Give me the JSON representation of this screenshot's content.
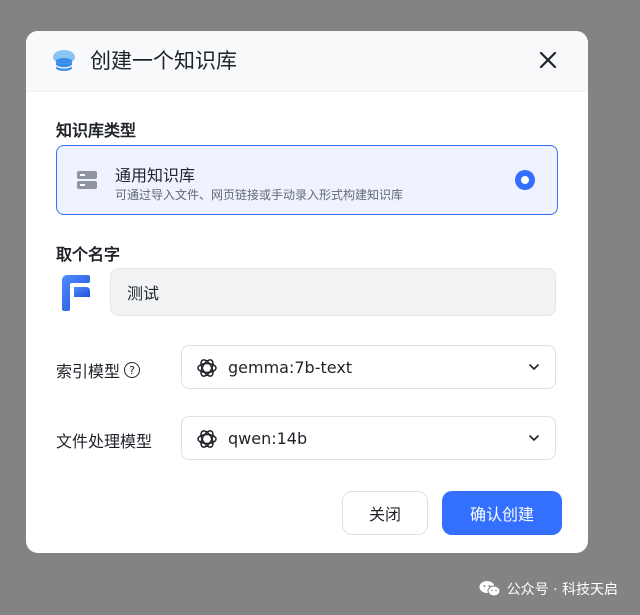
{
  "dialog": {
    "title": "创建一个知识库",
    "type_section_label": "知识库类型",
    "kb_type": {
      "title": "通用知识库",
      "description": "可通过导入文件、网页链接或手动录入形式构建知识库",
      "selected": true
    },
    "name_section_label": "取个名字",
    "name_value": "测试",
    "index_model": {
      "label": "索引模型",
      "value": "gemma:7b-text"
    },
    "file_model": {
      "label": "文件处理模型",
      "value": "qwen:14b"
    },
    "close_label": "关闭",
    "confirm_label": "确认创建"
  },
  "watermark": {
    "text": "公众号 · 科技天启"
  },
  "colors": {
    "accent": "#3370ff",
    "overlay": "#838383",
    "card_bg": "#eef3ff"
  },
  "icons": [
    "database-cloud-icon",
    "close-icon",
    "database-icon",
    "radio-checked-icon",
    "avatar-logo-icon",
    "help-icon",
    "openai-icon",
    "chevron-down-icon",
    "wechat-icon"
  ]
}
